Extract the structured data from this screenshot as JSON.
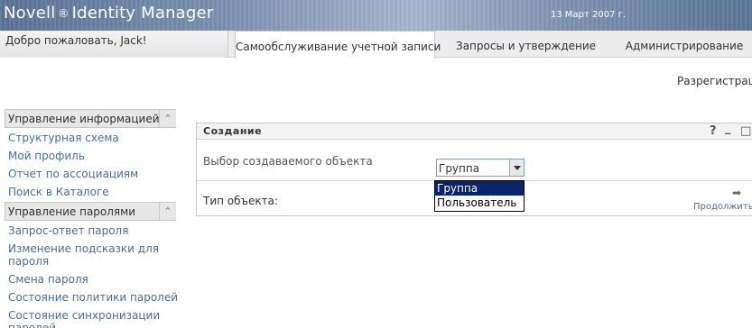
{
  "header": {
    "brand_name": "Novell",
    "brand_registered": "®",
    "product_name": "Identity Manager",
    "date": "13 Март 2007 г."
  },
  "welcome": "Добро пожаловать, Jack!",
  "tabs": [
    {
      "label": "Самообслуживание учетной записи",
      "active": true
    },
    {
      "label": "Запросы и утверждение",
      "active": false
    },
    {
      "label": "Администрирование",
      "active": false
    }
  ],
  "logout": "Разрегистрация",
  "sidebar": {
    "sections": [
      {
        "title": "Управление информацией",
        "collapse_icon": "double-chevron-up-icon",
        "items": [
          "Структурная схема",
          "Мой профиль",
          "Отчет по ассоциациям",
          "Поиск в Каталоге"
        ]
      },
      {
        "title": "Управление паролями",
        "collapse_icon": "double-chevron-up-icon",
        "items": [
          "Запрос-ответ пароля",
          "Изменение подсказки для пароля",
          "Смена пароля",
          "Состояние политики паролей",
          "Состояние синхронизации паролей"
        ]
      }
    ]
  },
  "portlet": {
    "title": "Создание",
    "help_icon": "?",
    "minimize_icon": "_",
    "maximize_icon": "□",
    "subtitle": "Выбор создаваемого объекта",
    "type_label": "Тип объекта:",
    "select_value": "Группа",
    "options": [
      "Группа",
      "Пользователь"
    ],
    "selected_option": "Группа",
    "continue_label": "Продолжить",
    "continue_icon": "➡"
  },
  "colors": {
    "banner": "#5a7598",
    "link": "#4a6e9a",
    "selection": "#0a246a"
  }
}
